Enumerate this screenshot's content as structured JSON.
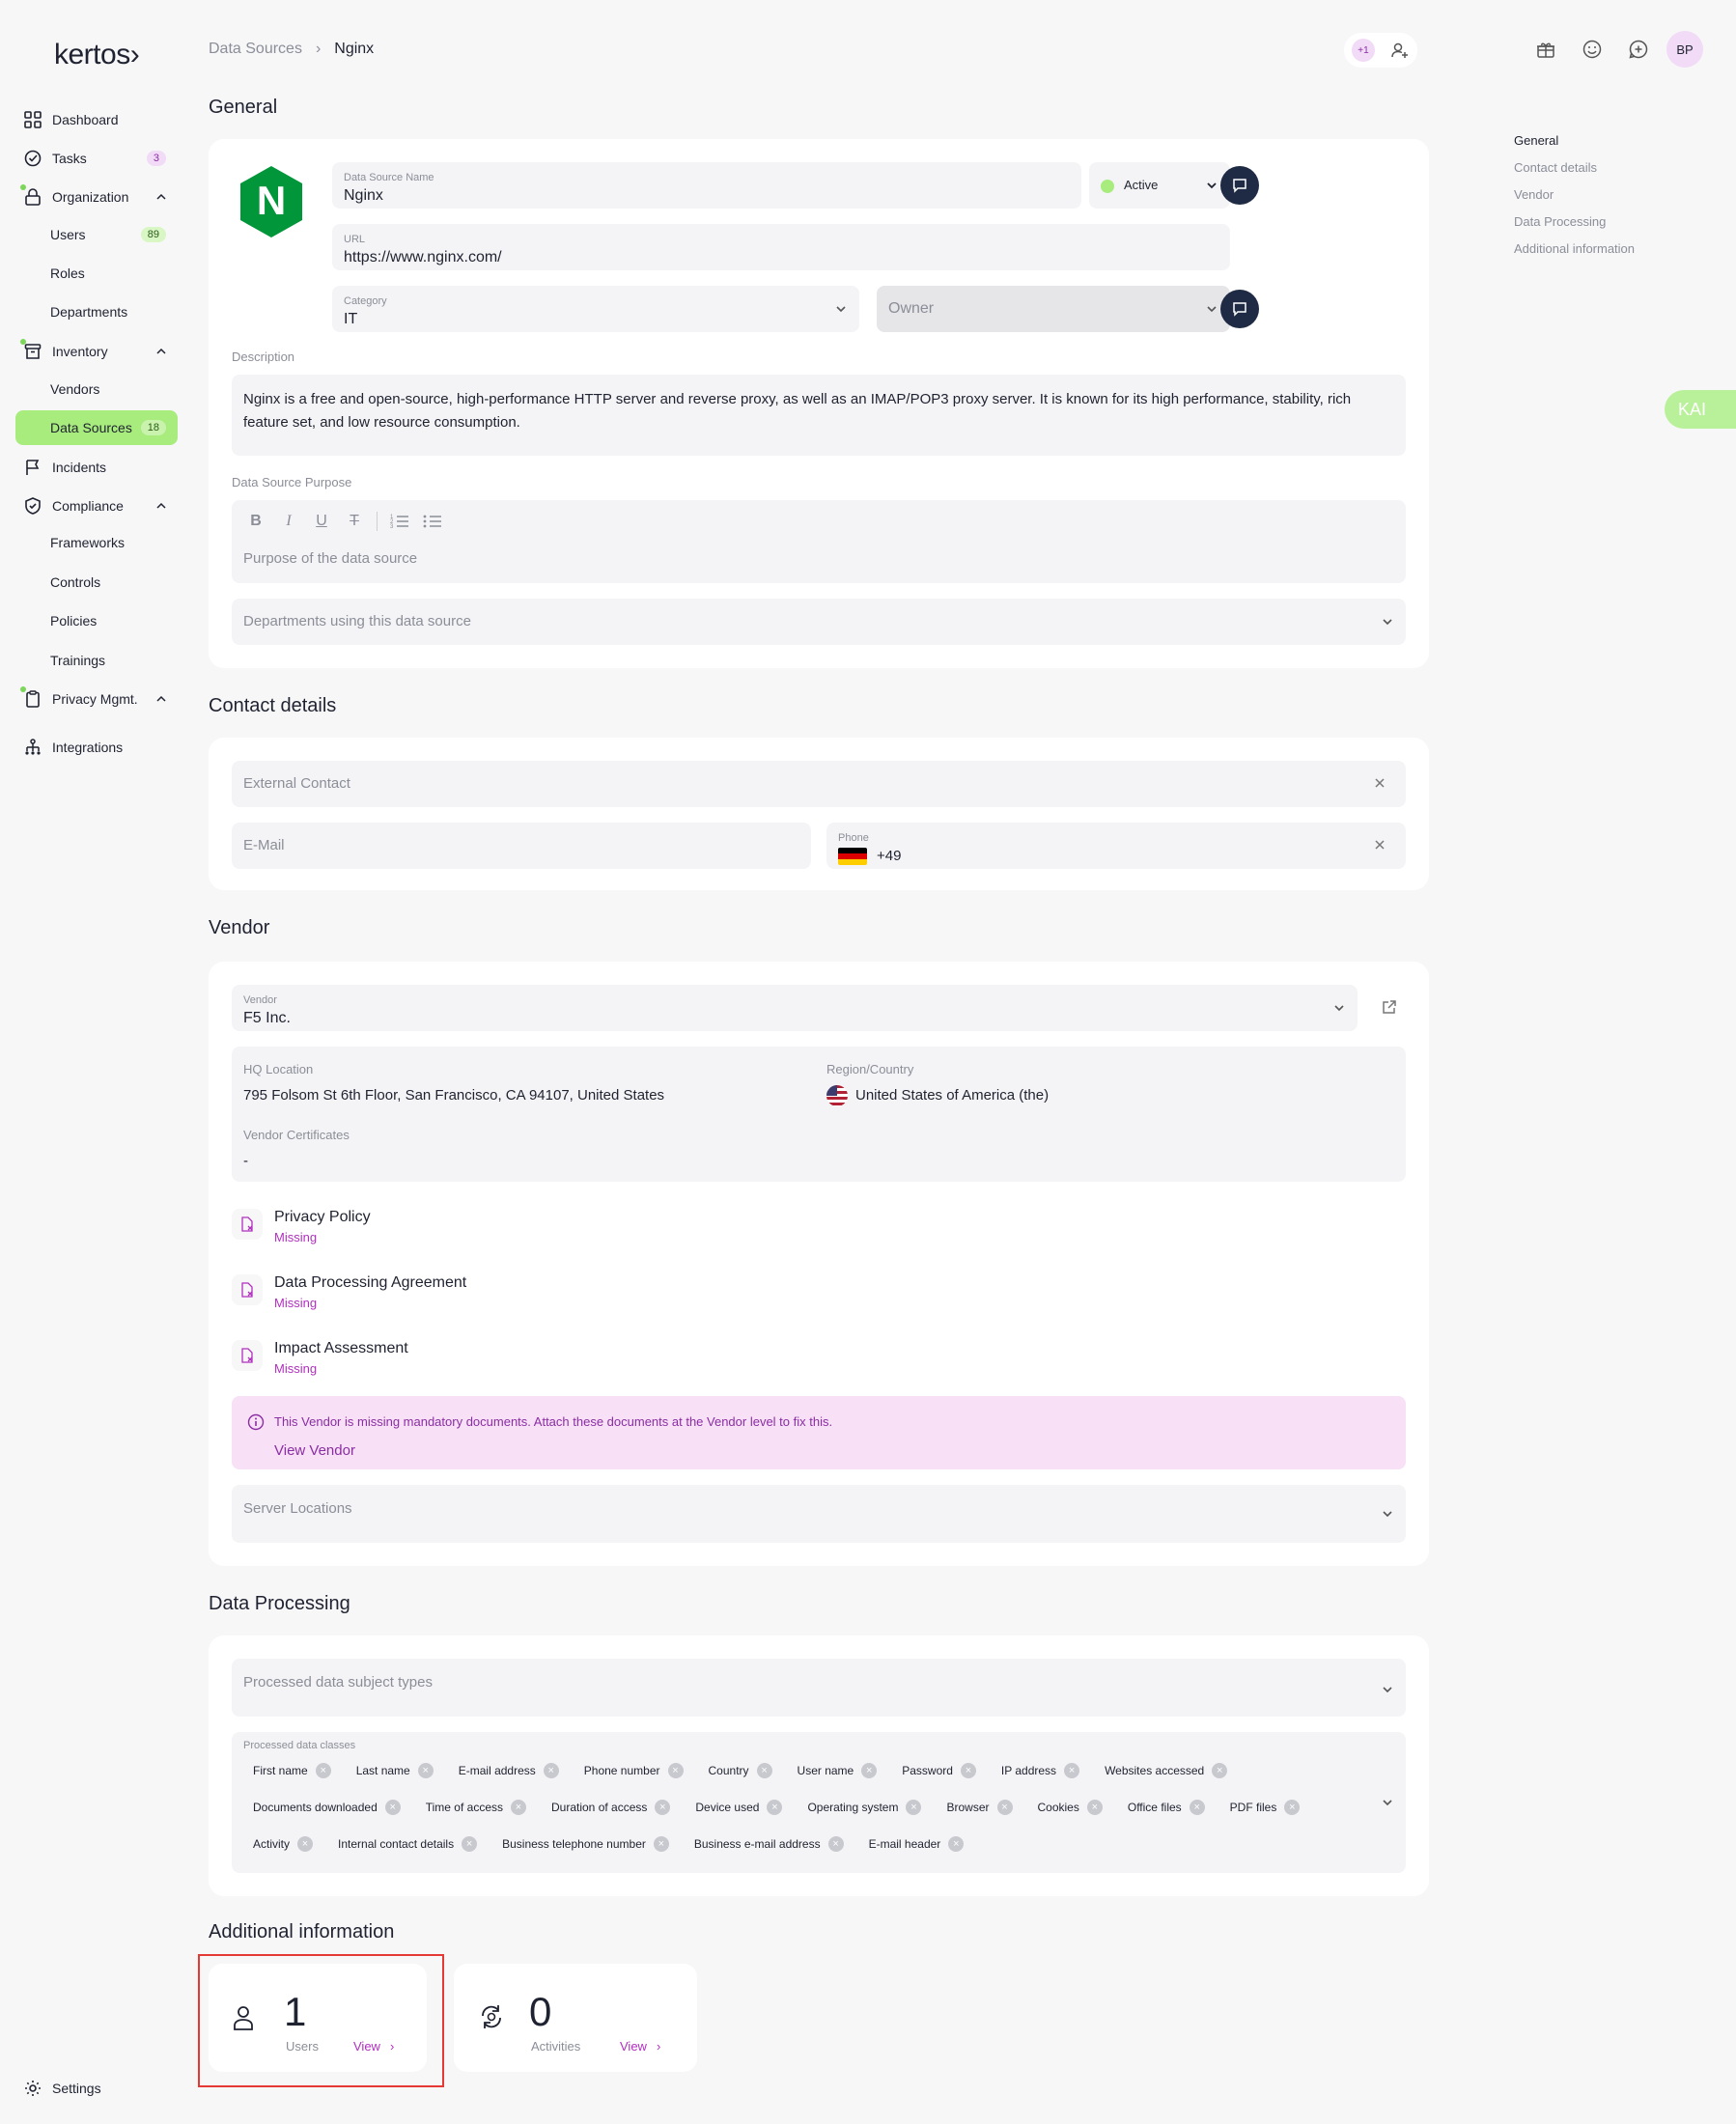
{
  "app": {
    "logo": "kertos›"
  },
  "sidebar": {
    "items": [
      {
        "label": "Dashboard"
      },
      {
        "label": "Tasks",
        "badge": "3"
      },
      {
        "label": "Organization"
      },
      {
        "label": "Users",
        "badge": "89"
      },
      {
        "label": "Roles"
      },
      {
        "label": "Departments"
      },
      {
        "label": "Inventory"
      },
      {
        "label": "Vendors"
      },
      {
        "label": "Data Sources",
        "badge": "18"
      },
      {
        "label": "Incidents"
      },
      {
        "label": "Compliance"
      },
      {
        "label": "Frameworks"
      },
      {
        "label": "Controls"
      },
      {
        "label": "Policies"
      },
      {
        "label": "Trainings"
      },
      {
        "label": "Privacy Mgmt."
      },
      {
        "label": "Integrations"
      }
    ],
    "settings_label": "Settings"
  },
  "header": {
    "breadcrumb": [
      "Data Sources",
      "Nginx"
    ],
    "collab_count": "+1",
    "avatar_initials": "BP"
  },
  "toc": [
    "General",
    "Contact details",
    "Vendor",
    "Data Processing",
    "Additional information"
  ],
  "kai_label": "KAI",
  "general": {
    "title": "General",
    "name_label": "Data Source Name",
    "name_value": "Nginx",
    "status_value": "Active",
    "url_label": "URL",
    "url_value": "https://www.nginx.com/",
    "category_label": "Category",
    "category_value": "IT",
    "owner_placeholder": "Owner",
    "description_label": "Description",
    "description_value": "Nginx is a free and open-source, high-performance HTTP server and reverse proxy, as well as an IMAP/POP3 proxy server. It is known for its high performance, stability, rich feature set, and low resource consumption.",
    "purpose_label": "Data Source Purpose",
    "purpose_placeholder": "Purpose of the data source",
    "departments_placeholder": "Departments using this data source",
    "logo_letter": "N"
  },
  "contact": {
    "title": "Contact details",
    "external_placeholder": "External Contact",
    "email_placeholder": "E-Mail",
    "phone_label": "Phone",
    "phone_value": "+49"
  },
  "vendor": {
    "title": "Vendor",
    "vendor_label": "Vendor",
    "vendor_value": "F5 Inc.",
    "hq_label": "HQ Location",
    "hq_value": "795 Folsom St 6th Floor, San Francisco, CA 94107, United States",
    "region_label": "Region/Country",
    "region_value": "United States of America (the)",
    "certs_label": "Vendor Certificates",
    "certs_value": "-",
    "docs": [
      {
        "title": "Privacy Policy",
        "status": "Missing"
      },
      {
        "title": "Data Processing Agreement",
        "status": "Missing"
      },
      {
        "title": "Impact Assessment",
        "status": "Missing"
      }
    ],
    "alert_text": "This Vendor is missing mandatory documents. Attach these documents at the Vendor level to fix this.",
    "alert_link": "View Vendor",
    "server_locations_placeholder": "Server Locations"
  },
  "processing": {
    "title": "Data Processing",
    "subject_types_placeholder": "Processed data subject types",
    "classes_label": "Processed data classes",
    "classes": [
      "First name",
      "Last name",
      "E-mail address",
      "Phone number",
      "Country",
      "User name",
      "Password",
      "IP address",
      "Websites accessed",
      "Documents downloaded",
      "Time of access",
      "Duration of access",
      "Device used",
      "Operating system",
      "Browser",
      "Cookies",
      "Office files",
      "PDF files",
      "Activity",
      "Internal contact details",
      "Business telephone number",
      "Business e-mail address",
      "E-mail header"
    ]
  },
  "additional": {
    "title": "Additional information",
    "users_count": "1",
    "users_label": "Users",
    "activities_count": "0",
    "activities_label": "Activities",
    "view_label": "View"
  },
  "colors": {
    "accent_green": "#a8ec7e",
    "accent_purple": "#b12fbf",
    "nginx_green": "#009639",
    "highlight_red": "#e53935"
  }
}
